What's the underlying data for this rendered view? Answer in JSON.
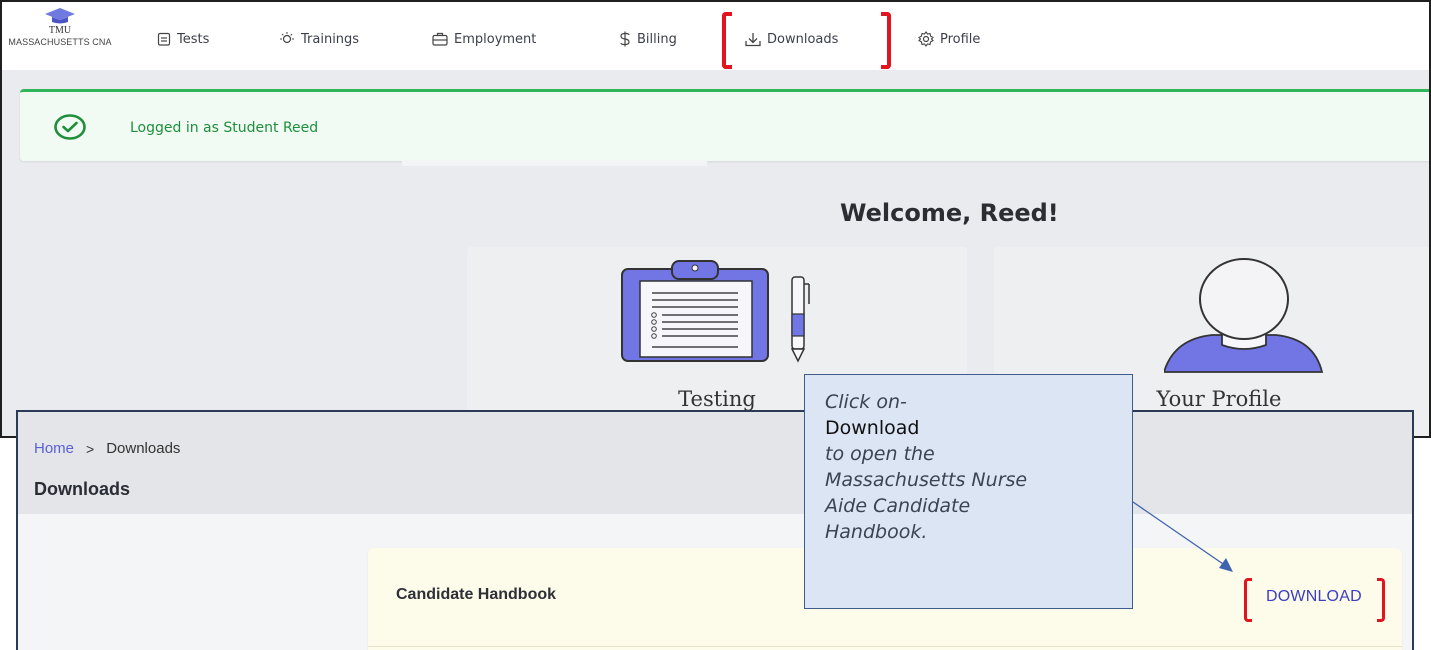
{
  "brand": {
    "top": "TMU",
    "sub": "MASSACHUSETTS CNA"
  },
  "nav": {
    "tests": "Tests",
    "trainings": "Trainings",
    "employment": "Employment",
    "billing": "Billing",
    "downloads": "Downloads",
    "profile": "Profile"
  },
  "alert": {
    "text": "Logged in as Student Reed"
  },
  "welcome": "Welcome, Reed!",
  "cards": {
    "testing": "Testing",
    "profile": "Your Profile"
  },
  "downloads_page": {
    "breadcrumb_home": "Home",
    "breadcrumb_sep": ">",
    "breadcrumb_current": "Downloads",
    "title": "Downloads",
    "item_name": "Candidate Handbook",
    "item_action": "DOWNLOAD"
  },
  "callout": {
    "line1": "Click on-",
    "line2": "Download",
    "line3": "to open the",
    "line4": "Massachusetts Nurse",
    "line5": "Aide Candidate",
    "line6": "Handbook."
  },
  "colors": {
    "highlight": "#e1141f",
    "accent": "#5a5fd8",
    "success": "#2fb55a",
    "callout_bg": "#dce5f3",
    "link": "#3b3ec4"
  }
}
